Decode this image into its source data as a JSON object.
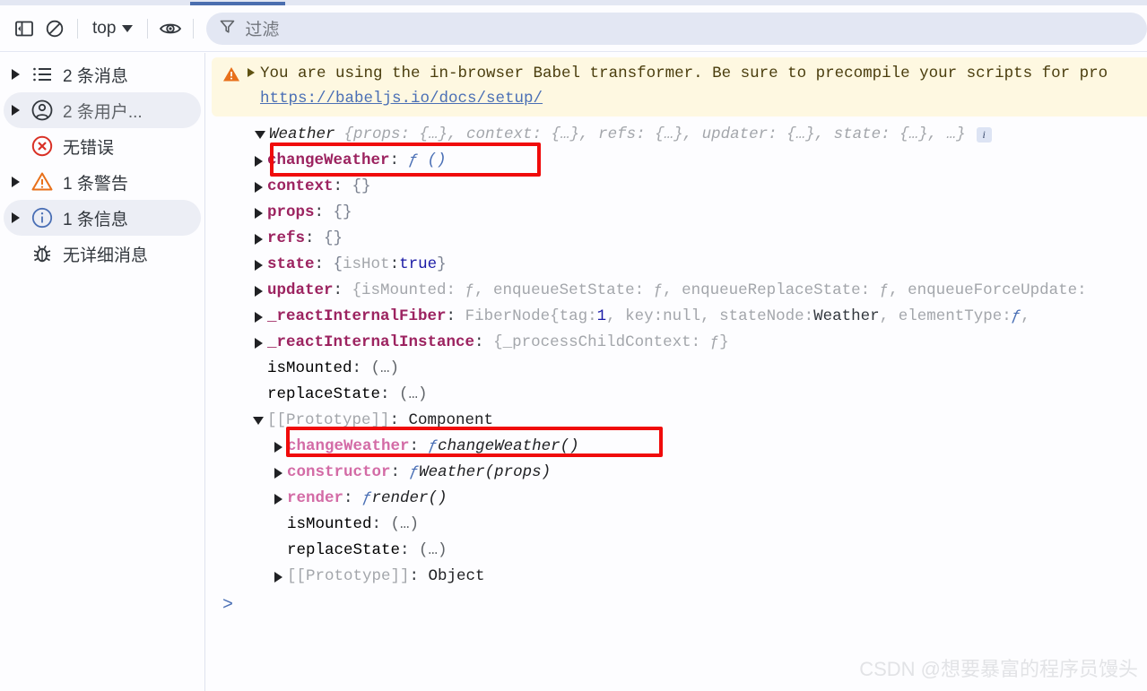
{
  "toolbar": {
    "sidebar_toggle_icon": "sidebar-panel-icon",
    "clear_console_icon": "no-entry-icon",
    "context_selector": "top",
    "eye_icon": "eye-icon",
    "filter_icon": "funnel-icon",
    "filter_placeholder": "过滤"
  },
  "sidebar": {
    "items": [
      {
        "label": "2 条消息",
        "icon": "list-icon",
        "expandable": true,
        "selected": false,
        "muted": false
      },
      {
        "label": "2 条用户...",
        "icon": "user-circle-icon",
        "expandable": true,
        "selected": true,
        "muted": true
      },
      {
        "label": "无错误",
        "icon": "error-circle-icon",
        "expandable": false,
        "selected": false,
        "muted": false
      },
      {
        "label": "1 条警告",
        "icon": "warning-triangle-icon",
        "expandable": true,
        "selected": false,
        "muted": false
      },
      {
        "label": "1 条信息",
        "icon": "info-circle-icon",
        "expandable": true,
        "selected": true,
        "muted": false
      },
      {
        "label": "无详细消息",
        "icon": "bug-icon",
        "expandable": false,
        "selected": false,
        "muted": false
      }
    ]
  },
  "console": {
    "warning": {
      "icon": "warning-triangle-icon",
      "text": "You are using the in-browser Babel transformer. Be sure to precompile your scripts for pro",
      "link": "https://babeljs.io/docs/setup/"
    },
    "object_root": {
      "name": "Weather",
      "preview": "{props: {…}, context: {…}, refs: {…}, updater: {…}, state: {…},  …}",
      "info_badge": "i"
    },
    "rows": [
      {
        "key": "changeWeather",
        "sep": ":",
        "value": "ƒ ()",
        "kind": "fn-anon",
        "style": "prop",
        "arrow": "right",
        "indent": 1,
        "highlighted": true
      },
      {
        "key": "context",
        "sep": ":",
        "value": "{}",
        "kind": "obj",
        "style": "prop",
        "arrow": "right",
        "indent": 1,
        "highlighted": false
      },
      {
        "key": "props",
        "sep": ":",
        "value": "{}",
        "kind": "obj",
        "style": "prop",
        "arrow": "right",
        "indent": 1,
        "highlighted": false
      },
      {
        "key": "refs",
        "sep": ":",
        "value": "{}",
        "kind": "obj",
        "style": "prop",
        "arrow": "right",
        "indent": 1,
        "highlighted": false
      },
      {
        "key": "state",
        "sep": ":",
        "value": "{isHot: true}",
        "kind": "state",
        "style": "prop",
        "arrow": "right",
        "indent": 1,
        "highlighted": false
      },
      {
        "key": "updater",
        "sep": ":",
        "value": "{isMounted: ƒ, enqueueSetState: ƒ, enqueueReplaceState: ƒ, enqueueForceUpdate:",
        "kind": "preview",
        "style": "prop",
        "arrow": "right",
        "indent": 1,
        "highlighted": false
      },
      {
        "key": "_reactInternalFiber",
        "sep": ":",
        "value": "FiberNode {tag: 1, key: null, stateNode: Weather, elementType: ƒ,",
        "kind": "fiber",
        "style": "prop",
        "arrow": "right",
        "indent": 1,
        "highlighted": false
      },
      {
        "key": "_reactInternalInstance",
        "sep": ":",
        "value": "{_processChildContext: ƒ}",
        "kind": "preview",
        "style": "prop",
        "arrow": "right",
        "indent": 1,
        "highlighted": false
      },
      {
        "key": "isMounted",
        "sep": ":",
        "value": "(…)",
        "kind": "getter",
        "style": "getter",
        "arrow": "none",
        "indent": 1,
        "highlighted": false
      },
      {
        "key": "replaceState",
        "sep": ":",
        "value": "(…)",
        "kind": "getter",
        "style": "getter",
        "arrow": "none",
        "indent": 1,
        "highlighted": false
      },
      {
        "key": "[[Prototype]]",
        "sep": ":",
        "value": "Component",
        "kind": "proto",
        "style": "proto-label",
        "arrow": "down",
        "indent": 1,
        "highlighted": false
      },
      {
        "key": "changeWeather",
        "sep": ":",
        "value": "ƒ changeWeather()",
        "kind": "fn-named",
        "style": "prop-proto",
        "arrow": "right",
        "indent": 2,
        "highlighted": true
      },
      {
        "key": "constructor",
        "sep": ":",
        "value": "ƒ Weather(props)",
        "kind": "fn-named",
        "style": "prop-proto",
        "arrow": "right",
        "indent": 2,
        "highlighted": false
      },
      {
        "key": "render",
        "sep": ":",
        "value": "ƒ render()",
        "kind": "fn-named",
        "style": "prop-proto",
        "arrow": "right",
        "indent": 2,
        "highlighted": false
      },
      {
        "key": "isMounted",
        "sep": ":",
        "value": "(…)",
        "kind": "getter",
        "style": "getter",
        "arrow": "none",
        "indent": 2,
        "highlighted": false
      },
      {
        "key": "replaceState",
        "sep": ":",
        "value": "(…)",
        "kind": "getter",
        "style": "getter",
        "arrow": "none",
        "indent": 2,
        "highlighted": false
      },
      {
        "key": "[[Prototype]]",
        "sep": ":",
        "value": "Object",
        "kind": "proto",
        "style": "proto-label",
        "arrow": "right",
        "indent": 2,
        "highlighted": false
      }
    ],
    "prompt_symbol": ">"
  },
  "watermark": "CSDN @想要暴富的程序员馒头",
  "colors": {
    "accent_blue": "#4b6eaf",
    "warning_bg": "#fef8e1",
    "warning_orange": "#e8701a",
    "error_red": "#d93025",
    "highlight_red": "#f00b0b",
    "property_magenta": "#9c2360",
    "prototype_pink": "#d36ba6",
    "filter_bg": "#e3e7f3"
  }
}
